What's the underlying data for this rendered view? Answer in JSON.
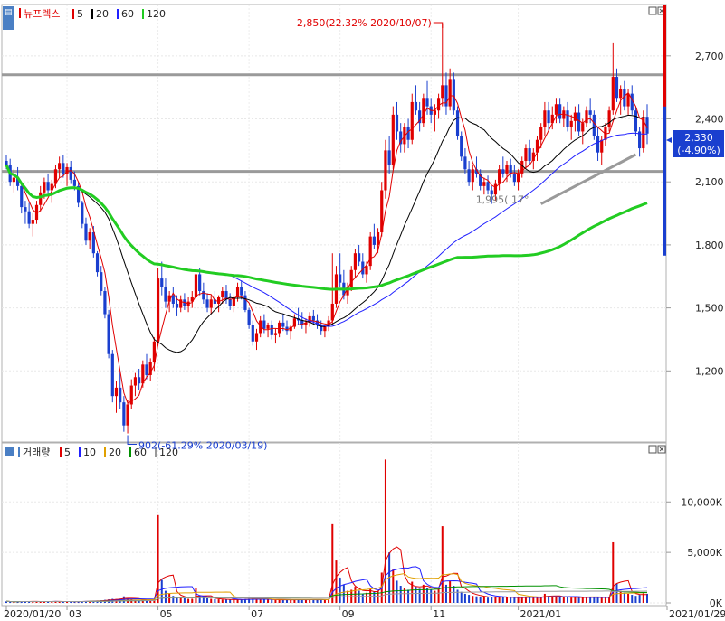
{
  "chart_data": {
    "type": "candlestick",
    "price_panel": {
      "stock_name": "뉴프렉스",
      "legend": [
        {
          "name": "5",
          "color": "#e00000"
        },
        {
          "name": "20",
          "color": "#000000"
        },
        {
          "name": "60",
          "color": "#2020ff"
        },
        {
          "name": "120",
          "color": "#22cc22"
        }
      ],
      "y_ticks": [
        "2,700",
        "2,400",
        "2,100",
        "1,800",
        "1,500",
        "1,200"
      ],
      "ylim": [
        900,
        2880
      ],
      "current_price": "2,330",
      "current_change": "(-4.90%)",
      "max_annotation": "2,850(22.32% 2020/10/07)",
      "min_annotation": "902(-61.29% 2020/03/19)",
      "trough_annotation": "1,995( 17°",
      "horizontal_levels": [
        2610,
        2150
      ],
      "trendline": [
        [
          141,
          1995
        ],
        [
          166,
          2230
        ]
      ],
      "candles": [
        [
          2200,
          2230,
          2160,
          2180
        ],
        [
          2180,
          2210,
          2080,
          2100
        ],
        [
          2100,
          2160,
          2050,
          2120
        ],
        [
          2120,
          2170,
          2060,
          2080
        ],
        [
          2080,
          2090,
          1950,
          1980
        ],
        [
          1980,
          2010,
          1900,
          1960
        ],
        [
          1960,
          2000,
          1880,
          1900
        ],
        [
          1900,
          1950,
          1840,
          1920
        ],
        [
          1920,
          2010,
          1900,
          1990
        ],
        [
          1990,
          2080,
          1960,
          2050
        ],
        [
          2050,
          2120,
          2020,
          2100
        ],
        [
          2100,
          2140,
          2040,
          2060
        ],
        [
          2060,
          2110,
          2000,
          2090
        ],
        [
          2090,
          2180,
          2070,
          2160
        ],
        [
          2160,
          2220,
          2120,
          2190
        ],
        [
          2190,
          2230,
          2120,
          2140
        ],
        [
          2140,
          2190,
          2080,
          2170
        ],
        [
          2170,
          2200,
          2090,
          2110
        ],
        [
          2110,
          2150,
          2060,
          2080
        ],
        [
          2080,
          2100,
          1980,
          2000
        ],
        [
          2000,
          2010,
          1880,
          1900
        ],
        [
          1900,
          1930,
          1800,
          1820
        ],
        [
          1820,
          1880,
          1780,
          1860
        ],
        [
          1860,
          1890,
          1740,
          1760
        ],
        [
          1760,
          1770,
          1650,
          1670
        ],
        [
          1670,
          1700,
          1560,
          1580
        ],
        [
          1580,
          1600,
          1450,
          1470
        ],
        [
          1470,
          1490,
          1260,
          1280
        ],
        [
          1280,
          1300,
          1050,
          1080
        ],
        [
          1080,
          1150,
          1000,
          1120
        ],
        [
          1120,
          1200,
          1020,
          1050
        ],
        [
          1050,
          1080,
          910,
          940
        ],
        [
          940,
          1060,
          902,
          1040
        ],
        [
          1040,
          1160,
          1020,
          1130
        ],
        [
          1130,
          1190,
          1080,
          1170
        ],
        [
          1170,
          1210,
          1110,
          1140
        ],
        [
          1140,
          1250,
          1120,
          1230
        ],
        [
          1230,
          1280,
          1160,
          1180
        ],
        [
          1180,
          1260,
          1150,
          1240
        ],
        [
          1240,
          1360,
          1200,
          1340
        ],
        [
          1340,
          1690,
          1320,
          1640
        ],
        [
          1640,
          1720,
          1560,
          1600
        ],
        [
          1600,
          1640,
          1500,
          1530
        ],
        [
          1530,
          1580,
          1480,
          1560
        ],
        [
          1560,
          1600,
          1500,
          1520
        ],
        [
          1520,
          1560,
          1460,
          1500
        ],
        [
          1500,
          1560,
          1480,
          1540
        ],
        [
          1540,
          1570,
          1490,
          1510
        ],
        [
          1510,
          1550,
          1480,
          1530
        ],
        [
          1530,
          1580,
          1500,
          1550
        ],
        [
          1550,
          1680,
          1540,
          1660
        ],
        [
          1660,
          1690,
          1560,
          1580
        ],
        [
          1580,
          1620,
          1520,
          1540
        ],
        [
          1540,
          1570,
          1480,
          1500
        ],
        [
          1500,
          1560,
          1470,
          1540
        ],
        [
          1540,
          1580,
          1500,
          1520
        ],
        [
          1520,
          1560,
          1480,
          1550
        ],
        [
          1550,
          1600,
          1520,
          1580
        ],
        [
          1580,
          1610,
          1520,
          1540
        ],
        [
          1540,
          1570,
          1490,
          1510
        ],
        [
          1510,
          1560,
          1480,
          1550
        ],
        [
          1550,
          1620,
          1530,
          1600
        ],
        [
          1600,
          1630,
          1540,
          1560
        ],
        [
          1560,
          1580,
          1480,
          1490
        ],
        [
          1490,
          1500,
          1400,
          1420
        ],
        [
          1420,
          1440,
          1320,
          1340
        ],
        [
          1340,
          1400,
          1300,
          1380
        ],
        [
          1380,
          1460,
          1360,
          1440
        ],
        [
          1440,
          1470,
          1380,
          1400
        ],
        [
          1400,
          1430,
          1360,
          1420
        ],
        [
          1420,
          1440,
          1350,
          1370
        ],
        [
          1370,
          1400,
          1330,
          1380
        ],
        [
          1380,
          1440,
          1360,
          1430
        ],
        [
          1430,
          1470,
          1390,
          1410
        ],
        [
          1410,
          1440,
          1370,
          1390
        ],
        [
          1390,
          1420,
          1350,
          1410
        ],
        [
          1410,
          1470,
          1400,
          1450
        ],
        [
          1450,
          1500,
          1420,
          1440
        ],
        [
          1440,
          1480,
          1400,
          1420
        ],
        [
          1420,
          1450,
          1380,
          1430
        ],
        [
          1430,
          1480,
          1410,
          1460
        ],
        [
          1460,
          1490,
          1420,
          1440
        ],
        [
          1440,
          1470,
          1400,
          1420
        ],
        [
          1420,
          1440,
          1370,
          1390
        ],
        [
          1390,
          1420,
          1360,
          1410
        ],
        [
          1410,
          1460,
          1390,
          1440
        ],
        [
          1440,
          1760,
          1420,
          1520
        ],
        [
          1520,
          1700,
          1500,
          1660
        ],
        [
          1660,
          1760,
          1600,
          1620
        ],
        [
          1620,
          1680,
          1540,
          1560
        ],
        [
          1560,
          1620,
          1520,
          1600
        ],
        [
          1600,
          1700,
          1580,
          1680
        ],
        [
          1680,
          1780,
          1640,
          1760
        ],
        [
          1760,
          1800,
          1700,
          1720
        ],
        [
          1720,
          1760,
          1640,
          1660
        ],
        [
          1660,
          1720,
          1620,
          1700
        ],
        [
          1700,
          1860,
          1680,
          1840
        ],
        [
          1840,
          1900,
          1780,
          1800
        ],
        [
          1800,
          1880,
          1760,
          1860
        ],
        [
          1860,
          2100,
          1840,
          2060
        ],
        [
          2060,
          2300,
          2020,
          2250
        ],
        [
          2250,
          2320,
          2140,
          2180
        ],
        [
          2180,
          2460,
          2160,
          2420
        ],
        [
          2420,
          2480,
          2300,
          2340
        ],
        [
          2340,
          2380,
          2240,
          2280
        ],
        [
          2280,
          2380,
          2240,
          2360
        ],
        [
          2360,
          2400,
          2260,
          2300
        ],
        [
          2300,
          2520,
          2280,
          2480
        ],
        [
          2480,
          2560,
          2420,
          2440
        ],
        [
          2440,
          2480,
          2340,
          2380
        ],
        [
          2380,
          2520,
          2360,
          2500
        ],
        [
          2500,
          2580,
          2420,
          2460
        ],
        [
          2460,
          2500,
          2380,
          2420
        ],
        [
          2420,
          2470,
          2340,
          2440
        ],
        [
          2440,
          2520,
          2400,
          2500
        ],
        [
          2500,
          2850,
          2460,
          2560
        ],
        [
          2560,
          2620,
          2420,
          2460
        ],
        [
          2460,
          2640,
          2440,
          2590
        ],
        [
          2590,
          2620,
          2420,
          2440
        ],
        [
          2440,
          2460,
          2300,
          2320
        ],
        [
          2320,
          2340,
          2200,
          2220
        ],
        [
          2220,
          2260,
          2140,
          2160
        ],
        [
          2160,
          2200,
          2080,
          2100
        ],
        [
          2100,
          2180,
          2060,
          2160
        ],
        [
          2160,
          2220,
          2120,
          2140
        ],
        [
          2140,
          2160,
          2060,
          2080
        ],
        [
          2080,
          2120,
          2040,
          2100
        ],
        [
          2100,
          2130,
          2040,
          2060
        ],
        [
          2060,
          2080,
          1995,
          2040
        ],
        [
          2040,
          2110,
          2010,
          2090
        ],
        [
          2090,
          2180,
          2060,
          2160
        ],
        [
          2160,
          2220,
          2120,
          2140
        ],
        [
          2140,
          2200,
          2100,
          2180
        ],
        [
          2180,
          2210,
          2120,
          2140
        ],
        [
          2140,
          2180,
          2080,
          2100
        ],
        [
          2100,
          2160,
          2060,
          2140
        ],
        [
          2140,
          2220,
          2120,
          2200
        ],
        [
          2200,
          2280,
          2160,
          2260
        ],
        [
          2260,
          2300,
          2180,
          2200
        ],
        [
          2200,
          2260,
          2160,
          2240
        ],
        [
          2240,
          2320,
          2200,
          2300
        ],
        [
          2300,
          2380,
          2260,
          2360
        ],
        [
          2360,
          2480,
          2320,
          2440
        ],
        [
          2440,
          2480,
          2340,
          2380
        ],
        [
          2380,
          2460,
          2350,
          2420
        ],
        [
          2420,
          2500,
          2380,
          2470
        ],
        [
          2470,
          2500,
          2380,
          2400
        ],
        [
          2400,
          2460,
          2360,
          2440
        ],
        [
          2440,
          2480,
          2340,
          2360
        ],
        [
          2360,
          2420,
          2300,
          2390
        ],
        [
          2390,
          2460,
          2340,
          2430
        ],
        [
          2430,
          2470,
          2320,
          2340
        ],
        [
          2340,
          2400,
          2280,
          2380
        ],
        [
          2380,
          2460,
          2360,
          2440
        ],
        [
          2440,
          2500,
          2380,
          2420
        ],
        [
          2420,
          2440,
          2300,
          2320
        ],
        [
          2320,
          2360,
          2200,
          2240
        ],
        [
          2240,
          2320,
          2180,
          2300
        ],
        [
          2300,
          2380,
          2270,
          2360
        ],
        [
          2360,
          2460,
          2340,
          2440
        ],
        [
          2440,
          2760,
          2420,
          2600
        ],
        [
          2600,
          2640,
          2480,
          2500
        ],
        [
          2500,
          2560,
          2420,
          2540
        ],
        [
          2540,
          2580,
          2440,
          2460
        ],
        [
          2460,
          2540,
          2420,
          2520
        ],
        [
          2520,
          2560,
          2420,
          2440
        ],
        [
          2440,
          2460,
          2320,
          2340
        ],
        [
          2340,
          2360,
          2220,
          2260
        ],
        [
          2260,
          2440,
          2240,
          2410
        ],
        [
          2410,
          2470,
          2280,
          2330
        ]
      ]
    },
    "volume_panel": {
      "label": "거래량",
      "legend": [
        {
          "name": "5",
          "color": "#e00000"
        },
        {
          "name": "10",
          "color": "#2020ff"
        },
        {
          "name": "20",
          "color": "#e0a000"
        },
        {
          "name": "60",
          "color": "#009000"
        },
        {
          "name": "120",
          "color": "#999999"
        }
      ],
      "y_ticks": [
        "10,000K",
        "5,000K",
        "0K"
      ],
      "ylim": [
        0,
        14500
      ],
      "volumes": [
        150,
        120,
        110,
        130,
        160,
        140,
        150,
        130,
        120,
        140,
        150,
        130,
        120,
        160,
        140,
        130,
        120,
        130,
        110,
        150,
        170,
        160,
        180,
        200,
        220,
        260,
        300,
        350,
        400,
        380,
        420,
        650,
        450,
        380,
        320,
        300,
        280,
        260,
        300,
        350,
        8700,
        2300,
        1200,
        900,
        700,
        600,
        500,
        450,
        400,
        380,
        1500,
        700,
        500,
        450,
        400,
        380,
        350,
        330,
        320,
        310,
        300,
        340,
        320,
        380,
        420,
        460,
        380,
        350,
        330,
        320,
        300,
        290,
        320,
        310,
        300,
        290,
        320,
        330,
        310,
        300,
        320,
        310,
        300,
        320,
        310,
        330,
        7800,
        4200,
        2500,
        1800,
        1200,
        1300,
        1600,
        1200,
        900,
        1000,
        1400,
        1100,
        1200,
        3000,
        14200,
        5000,
        3300,
        2200,
        1700,
        1500,
        1300,
        2100,
        1600,
        1400,
        1800,
        1500,
        1300,
        1200,
        1400,
        7600,
        1800,
        2200,
        1700,
        1300,
        1100,
        900,
        800,
        700,
        650,
        600,
        550,
        520,
        600,
        580,
        620,
        560,
        540,
        520,
        500,
        520,
        560,
        600,
        540,
        520,
        560,
        620,
        900,
        700,
        620,
        640,
        580,
        560,
        540,
        520,
        560,
        540,
        520,
        560,
        600,
        520,
        540,
        520,
        560,
        620,
        6000,
        1900,
        1200,
        1000,
        900,
        800,
        700,
        800,
        950,
        900
      ]
    },
    "x_ticks": [
      "2020/01/20",
      "03",
      "05",
      "07",
      "09",
      "11",
      "2021/01",
      "2021/01/29"
    ]
  }
}
